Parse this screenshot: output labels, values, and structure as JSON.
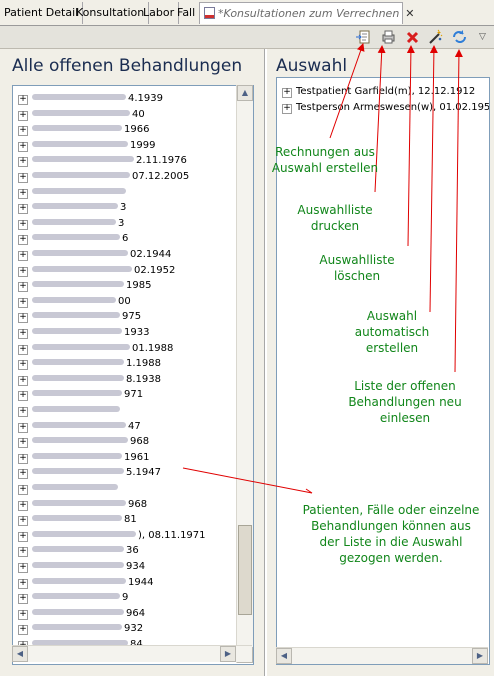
{
  "tabs": [
    {
      "label": "Patient Detail"
    },
    {
      "label": "Konsultation"
    },
    {
      "label": "Labor"
    },
    {
      "label": "Fall"
    },
    {
      "label": "*Konsultationen zum Verrechnen",
      "close": "✕"
    }
  ],
  "toolbar": {
    "icons": [
      "invoice-from-selection-icon",
      "print-selection-icon",
      "delete-selection-icon",
      "auto-create-selection-icon",
      "reload-icon",
      "view-menu-icon"
    ]
  },
  "left": {
    "title": "Alle offenen Behandlungen",
    "rows": [
      "4.1939",
      "40",
      "1966",
      "1999",
      "2.11.1976",
      "07.12.2005",
      "",
      "3",
      "3",
      "6",
      "02.1944",
      "02.1952",
      "1985",
      "00",
      "975",
      "1933",
      "01.1988",
      "1.1988",
      "8.1938",
      "971",
      "",
      "47",
      "968",
      "1961",
      "5.1947",
      "",
      "968",
      "81",
      "), 08.11.1971",
      "36",
      "934",
      "1944",
      "9",
      "964",
      "932",
      "84"
    ]
  },
  "right": {
    "title": "Auswahl",
    "rows": [
      "Testpatient Garfield(m), 12.12.1912",
      "Testperson Armeswesen(w), 01.02.1950"
    ]
  },
  "annotations": {
    "a1": [
      "Rechnungen aus",
      "Auswahl erstellen"
    ],
    "a2": [
      "Auswahlliste",
      "drucken"
    ],
    "a3": [
      "Auswahlliste",
      "löschen"
    ],
    "a4": [
      "Auswahl",
      "automatisch",
      "erstellen"
    ],
    "a5": [
      "Liste der offenen",
      "Behandlungen neu",
      "einlesen"
    ],
    "a6": [
      "Patienten, Fälle oder einzelne",
      "Behandlungen können aus",
      "der Liste in die Auswahl",
      "gezogen werden."
    ]
  },
  "colors": {
    "annotation": "#11861a",
    "arrow": "#e00000",
    "title": "#1a2c50"
  }
}
